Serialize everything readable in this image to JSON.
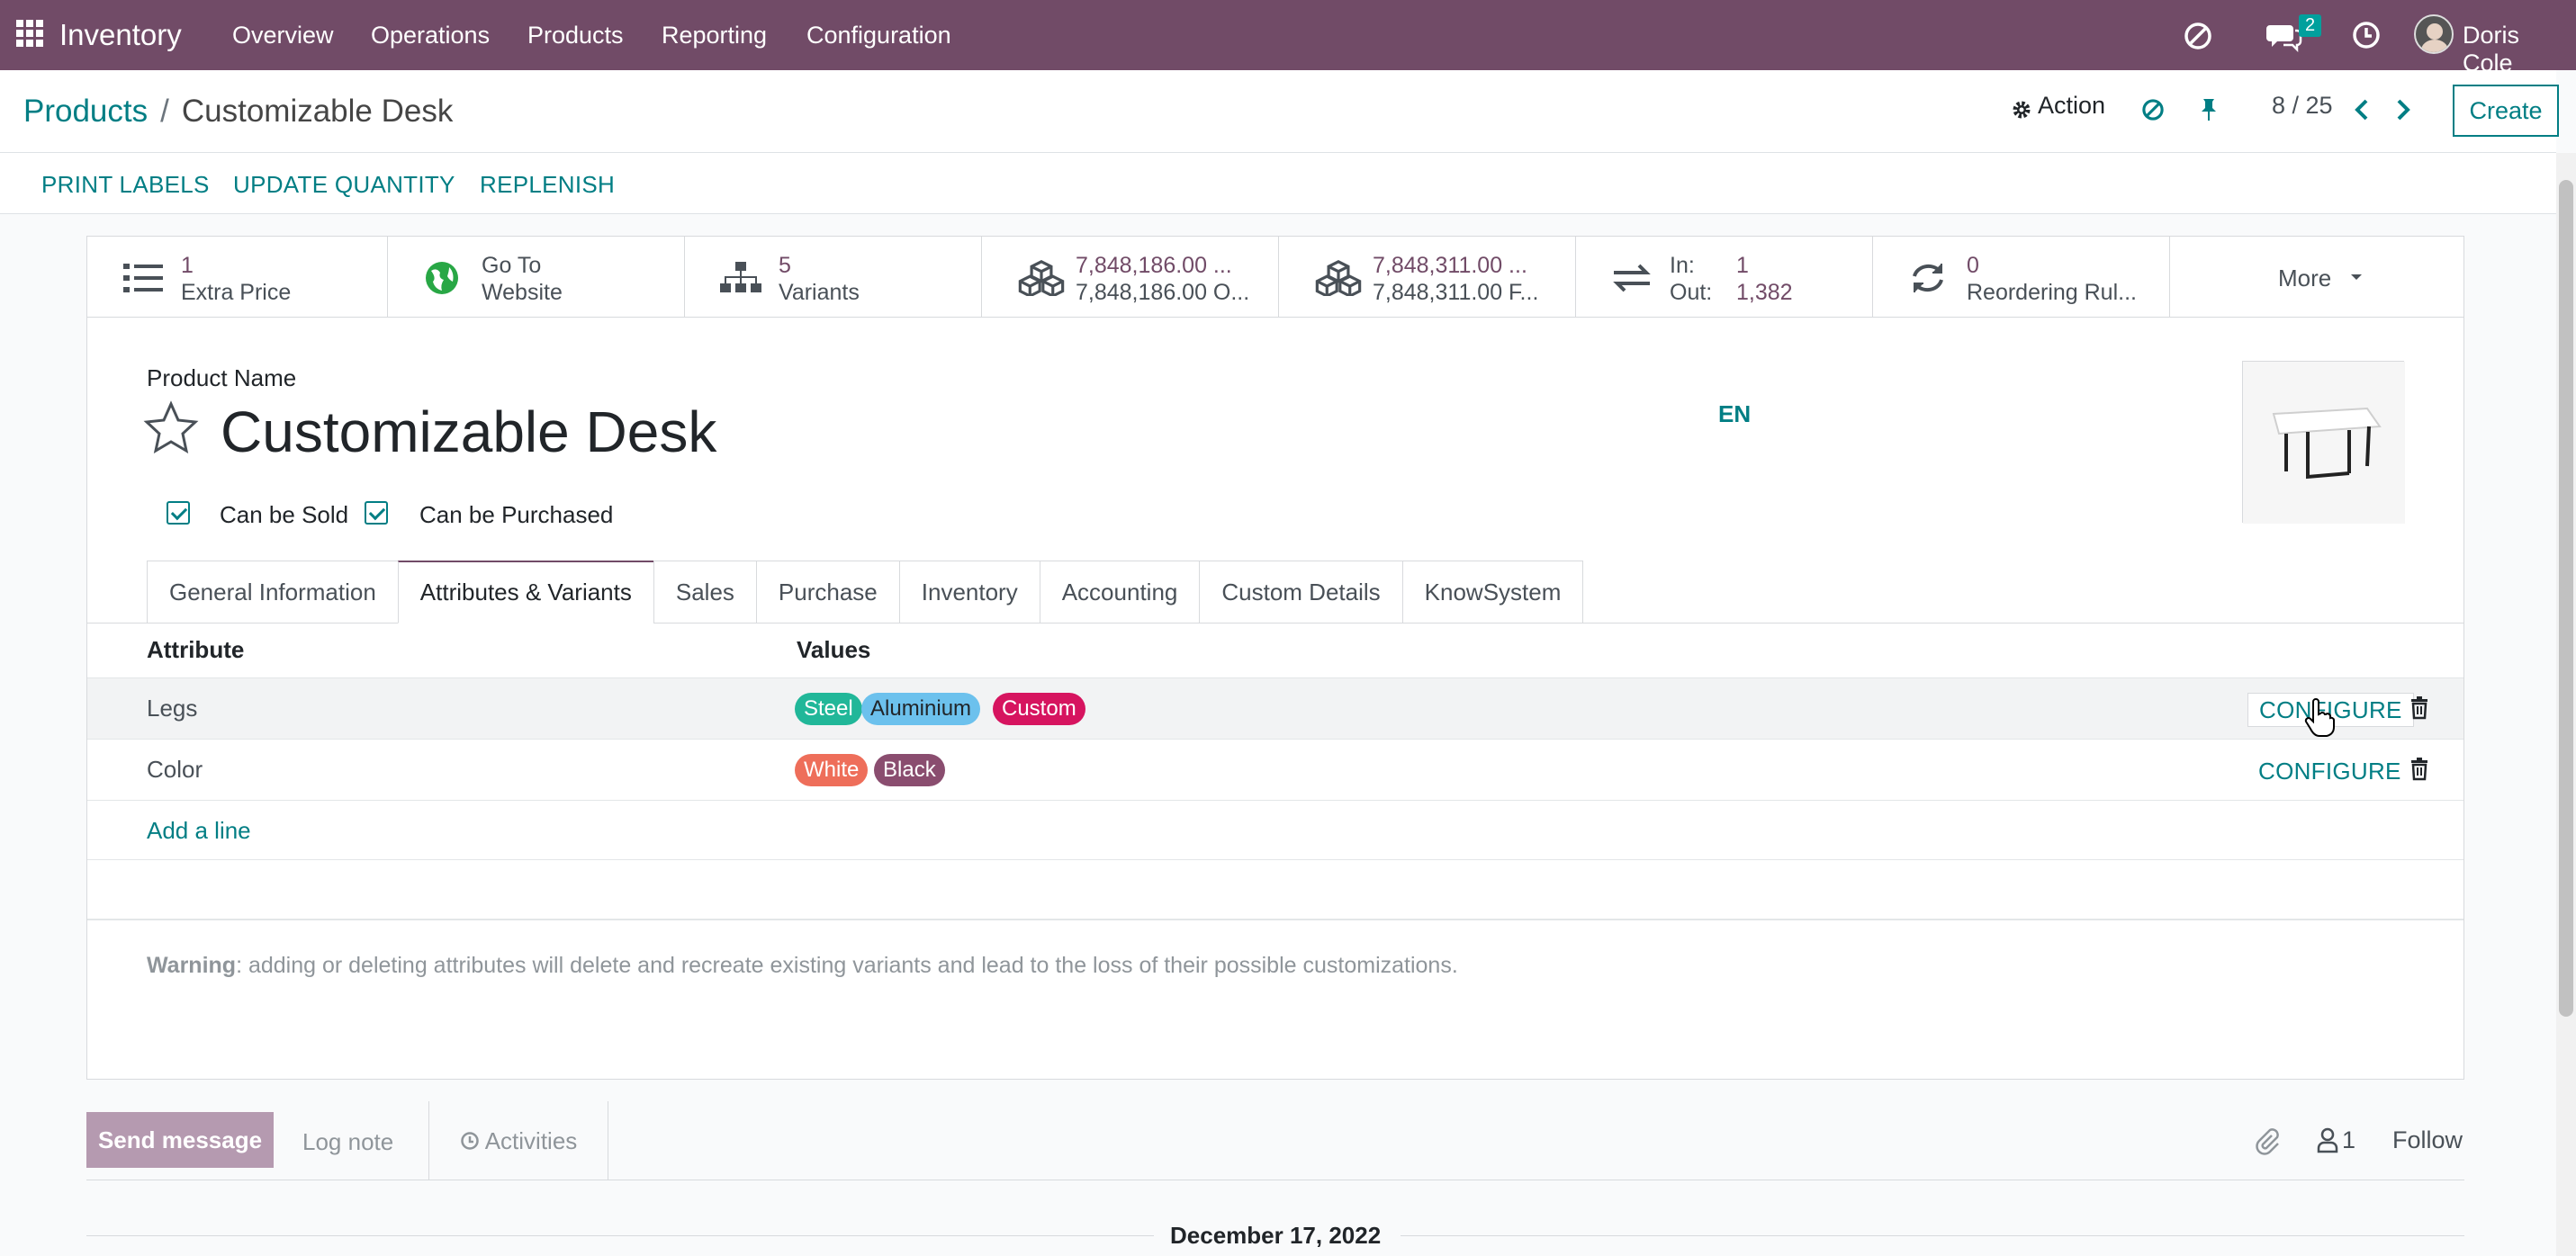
{
  "navbar": {
    "brand": "Inventory",
    "menu": [
      "Overview",
      "Operations",
      "Products",
      "Reporting",
      "Configuration"
    ],
    "messages_badge": "2",
    "user": "Doris Cole"
  },
  "control_panel": {
    "breadcrumb_parent": "Products",
    "breadcrumb_sep": "/",
    "breadcrumb_current": "Customizable Desk",
    "action_label": "Action",
    "pager": "8 / 25",
    "create_label": "Create"
  },
  "statusbar": {
    "buttons": [
      "PRINT LABELS",
      "UPDATE QUANTITY",
      "REPLENISH"
    ]
  },
  "smart_buttons": [
    {
      "line1": "1",
      "line2": "Extra Price",
      "icon": "list-icon"
    },
    {
      "line1": "Go To",
      "line2": "Website",
      "icon": "globe-icon"
    },
    {
      "line1": "5",
      "line2": "Variants",
      "icon": "sitemap-icon"
    },
    {
      "line1": "7,848,186.00 ...",
      "line2": "7,848,186.00 O...",
      "icon": "cubes-icon"
    },
    {
      "line1": "7,848,311.00 ...",
      "line2": "7,848,311.00 F...",
      "icon": "cubes-icon"
    },
    {
      "line1_label": "In:",
      "line1": "1",
      "line2_label": "Out:",
      "line2": "1,382",
      "icon": "exchange-icon"
    },
    {
      "line1": "0",
      "line2": "Reordering Rul...",
      "icon": "refresh-icon"
    }
  ],
  "more_label": "More",
  "form": {
    "product_name_label": "Product Name",
    "product_name": "Customizable Desk",
    "lang": "EN",
    "can_be_sold": "Can be Sold",
    "can_be_purchased": "Can be Purchased"
  },
  "tabs": [
    "General Information",
    "Attributes & Variants",
    "Sales",
    "Purchase",
    "Inventory",
    "Accounting",
    "Custom Details",
    "KnowSystem"
  ],
  "active_tab": "Attributes & Variants",
  "table": {
    "headers": [
      "Attribute",
      "Values"
    ],
    "rows": [
      {
        "attribute": "Legs",
        "values": [
          {
            "label": "Steel",
            "color": "#21b799"
          },
          {
            "label": "Aluminium",
            "color": "#6cc1ed"
          },
          {
            "label": "Custom",
            "color": "#d6145f"
          }
        ],
        "action": "CONFIGURE"
      },
      {
        "attribute": "Color",
        "values": [
          {
            "label": "White",
            "color": "#ee6e5a"
          },
          {
            "label": "Black",
            "color": "#8a4d6f"
          }
        ],
        "action": "CONFIGURE"
      }
    ],
    "add_line": "Add a line"
  },
  "warning_bold": "Warning",
  "warning_text": ": adding or deleting attributes will delete and recreate existing variants and lead to the loss of their possible customizations.",
  "chatter": {
    "send_message": "Send message",
    "log_note": "Log note",
    "activities": "Activities",
    "followers_count": "1",
    "follow": "Follow",
    "date": "December 17, 2022"
  }
}
